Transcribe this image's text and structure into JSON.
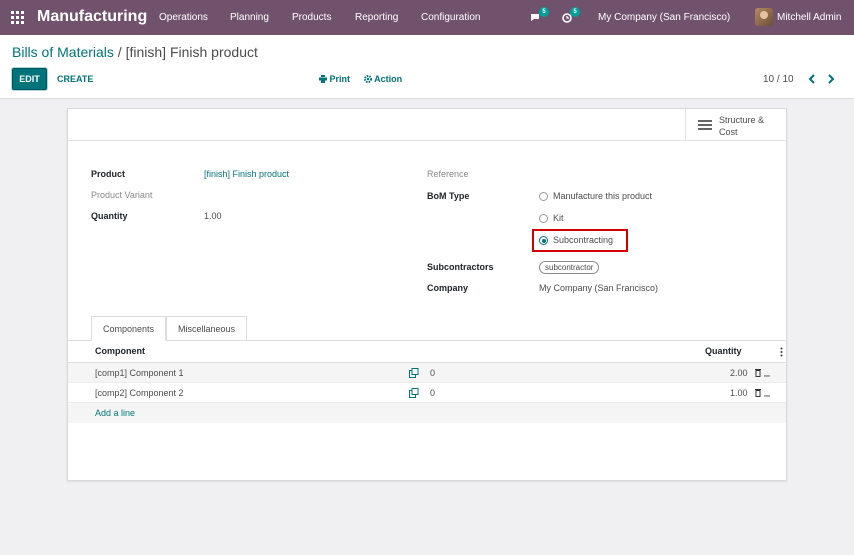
{
  "navbar": {
    "brand": "Manufacturing",
    "menu": [
      "Operations",
      "Planning",
      "Products",
      "Reporting",
      "Configuration"
    ],
    "messages_count": "5",
    "activities_count": "5",
    "company": "My Company (San Francisco)",
    "user": "Mitchell Admin"
  },
  "breadcrumb": {
    "parent": "Bills of Materials",
    "separator": " / ",
    "current": "[finish] Finish product"
  },
  "toolbar": {
    "edit_label": "EDIT",
    "create_label": "CREATE",
    "print_label": "Print",
    "action_label": "Action"
  },
  "pager": {
    "value": "10 / 10"
  },
  "structure_button": {
    "label": "Structure & Cost"
  },
  "form": {
    "product_label": "Product",
    "product_value": "[finish] Finish product",
    "variant_label": "Product Variant",
    "quantity_label": "Quantity",
    "quantity_value": "1.00",
    "reference_label": "Reference",
    "bom_type_label": "BoM Type",
    "bom_type_options": [
      "Manufacture this product",
      "Kit",
      "Subcontracting"
    ],
    "bom_type_selected": "Subcontracting",
    "subcontractors_label": "Subcontractors",
    "subcontractor_tag": "subcontractor",
    "company_label": "Company",
    "company_value": "My Company (San Francisco)"
  },
  "tabs": [
    "Components",
    "Miscellaneous"
  ],
  "table": {
    "headers": {
      "component": "Component",
      "quantity": "Quantity"
    },
    "rows": [
      {
        "component": "[comp1] Component 1",
        "forecast": "0",
        "quantity": "2.00"
      },
      {
        "component": "[comp2] Component 2",
        "forecast": "0",
        "quantity": "1.00"
      }
    ],
    "add_line": "Add a line"
  },
  "colors": {
    "navbar": "#71526c",
    "accent": "#00747a",
    "highlight": "#d40000"
  }
}
